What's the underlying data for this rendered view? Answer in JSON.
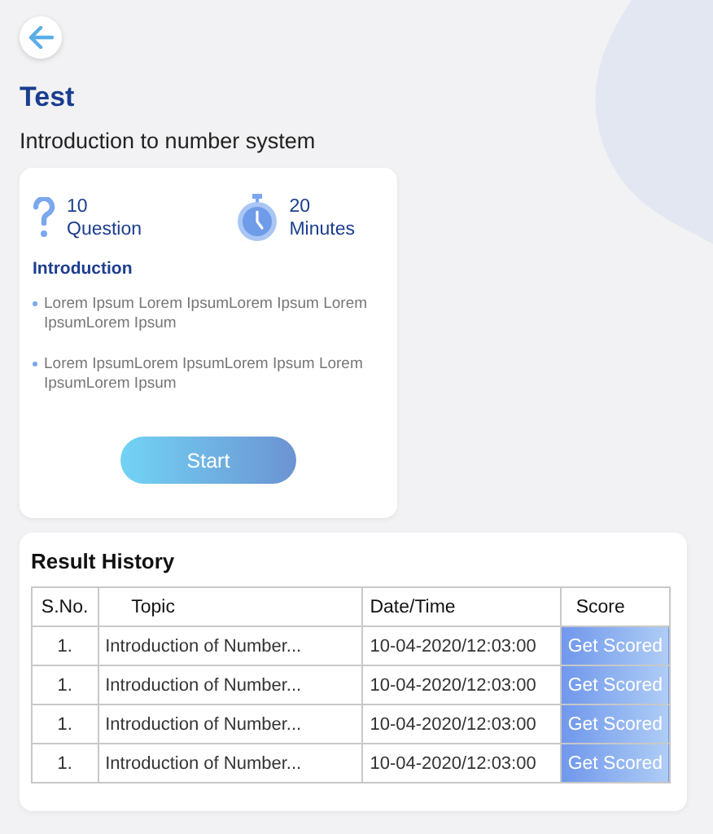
{
  "title": "Test",
  "subtitle": "Introduction to number system",
  "test_card": {
    "questions": {
      "count": "10",
      "label": "Question"
    },
    "duration": {
      "count": "20",
      "label": "Minutes"
    },
    "section_title": "Introduction",
    "points": [
      "Lorem Ipsum Lorem IpsumLorem Ipsum Lorem IpsumLorem Ipsum",
      "Lorem IpsumLorem IpsumLorem Ipsum Lorem IpsumLorem Ipsum"
    ],
    "start_button": "Start"
  },
  "result_history": {
    "title": "Result History",
    "columns": [
      "S.No.",
      "Topic",
      "Date/Time",
      "Score"
    ],
    "rows": [
      {
        "sno": "1.",
        "topic": "Introduction of Number...",
        "datetime": "10-04-2020/12:03:00",
        "action": "Get Scored"
      },
      {
        "sno": "1.",
        "topic": "Introduction of Number...",
        "datetime": "10-04-2020/12:03:00",
        "action": "Get Scored"
      },
      {
        "sno": "1.",
        "topic": "Introduction of Number...",
        "datetime": "10-04-2020/12:03:00",
        "action": "Get Scored"
      },
      {
        "sno": "1.",
        "topic": "Introduction of Number...",
        "datetime": "10-04-2020/12:03:00",
        "action": "Get Scored"
      }
    ]
  }
}
